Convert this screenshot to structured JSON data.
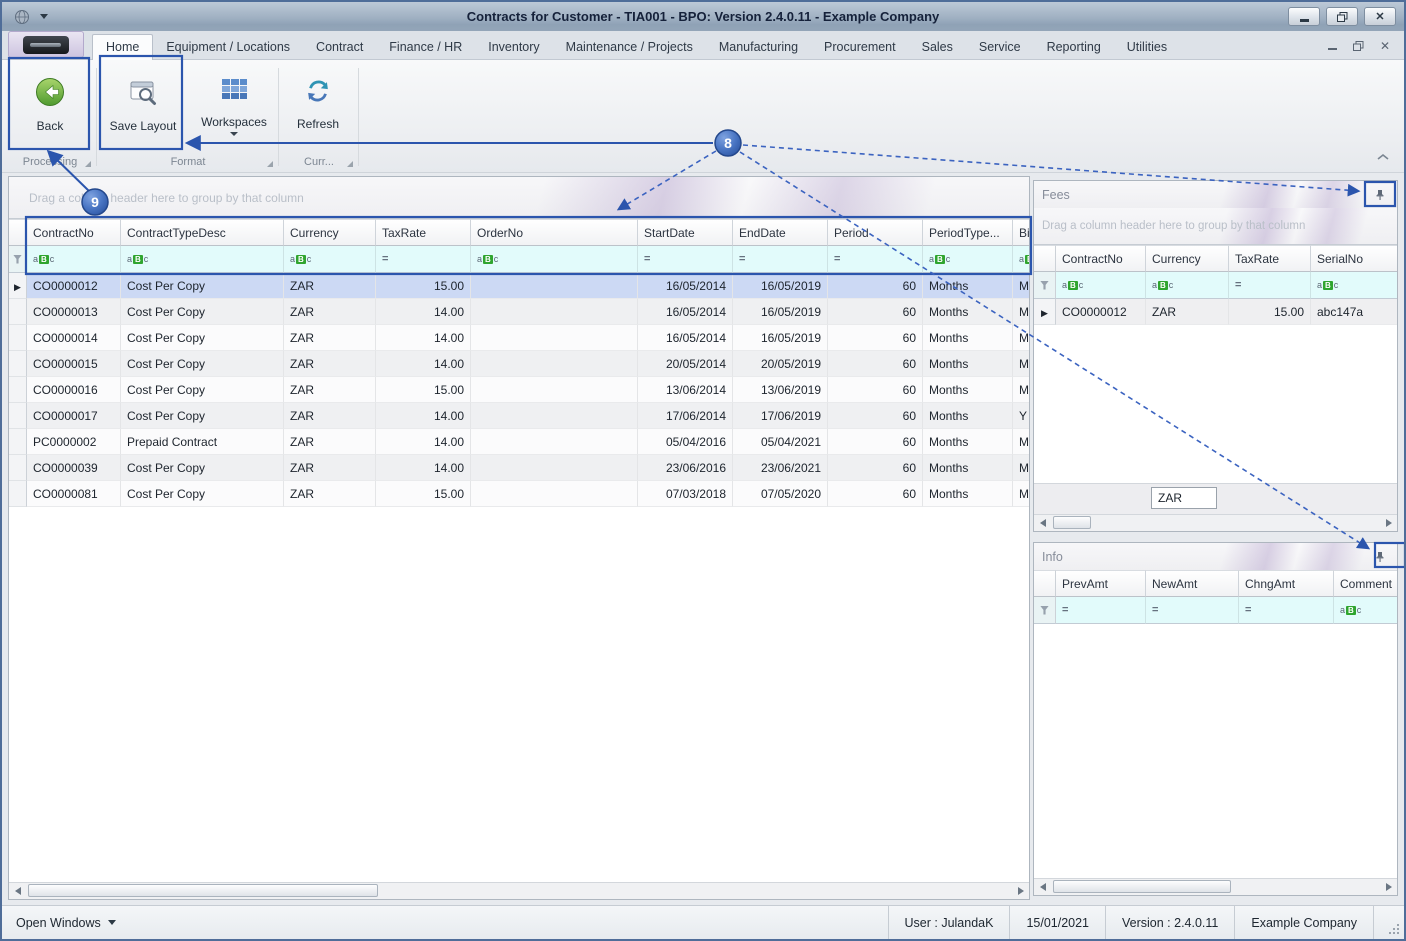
{
  "window": {
    "title": "Contracts for Customer - TIA001 - BPO: Version 2.4.0.11 - Example Company"
  },
  "ribbon": {
    "tabs": [
      {
        "label": "Home",
        "active": true
      },
      {
        "label": "Equipment / Locations"
      },
      {
        "label": "Contract"
      },
      {
        "label": "Finance / HR"
      },
      {
        "label": "Inventory"
      },
      {
        "label": "Maintenance / Projects"
      },
      {
        "label": "Manufacturing"
      },
      {
        "label": "Procurement"
      },
      {
        "label": "Sales"
      },
      {
        "label": "Service"
      },
      {
        "label": "Reporting"
      },
      {
        "label": "Utilities"
      }
    ],
    "buttons": {
      "back": "Back",
      "save_layout": "Save Layout",
      "workspaces": "Workspaces",
      "refresh": "Refresh"
    },
    "groups": {
      "processing": "Processing",
      "format": "Format",
      "currency": "Curr..."
    }
  },
  "main_grid": {
    "group_panel_text": "Drag a column header here to group by that column",
    "columns": [
      "ContractNo",
      "ContractTypeDesc",
      "Currency",
      "TaxRate",
      "OrderNo",
      "StartDate",
      "EndDate",
      "Period",
      "PeriodType...",
      "Bil"
    ],
    "filters": [
      "abc",
      "abc",
      "abc",
      "eq",
      "abc",
      "eq",
      "eq",
      "eq",
      "abc",
      "abc"
    ],
    "rows": [
      {
        "arrow": true,
        "selected": true,
        "cells": [
          "CO0000012",
          "Cost Per Copy",
          "ZAR",
          "15.00",
          "",
          "16/05/2014",
          "16/05/2019",
          "60",
          "Months",
          "M"
        ]
      },
      {
        "cells": [
          "CO0000013",
          "Cost Per Copy",
          "ZAR",
          "14.00",
          "",
          "16/05/2014",
          "16/05/2019",
          "60",
          "Months",
          "M"
        ]
      },
      {
        "cells": [
          "CO0000014",
          "Cost Per Copy",
          "ZAR",
          "14.00",
          "",
          "16/05/2014",
          "16/05/2019",
          "60",
          "Months",
          "M"
        ]
      },
      {
        "cells": [
          "CO0000015",
          "Cost Per Copy",
          "ZAR",
          "14.00",
          "",
          "20/05/2014",
          "20/05/2019",
          "60",
          "Months",
          "M"
        ]
      },
      {
        "cells": [
          "CO0000016",
          "Cost Per Copy",
          "ZAR",
          "15.00",
          "",
          "13/06/2014",
          "13/06/2019",
          "60",
          "Months",
          "M"
        ]
      },
      {
        "cells": [
          "CO0000017",
          "Cost Per Copy",
          "ZAR",
          "14.00",
          "",
          "17/06/2014",
          "17/06/2019",
          "60",
          "Months",
          "Y"
        ]
      },
      {
        "cells": [
          "PC0000002",
          "Prepaid Contract",
          "ZAR",
          "14.00",
          "",
          "05/04/2016",
          "05/04/2021",
          "60",
          "Months",
          "M"
        ]
      },
      {
        "cells": [
          "CO0000039",
          "Cost Per Copy",
          "ZAR",
          "14.00",
          "",
          "23/06/2016",
          "23/06/2021",
          "60",
          "Months",
          "M"
        ]
      },
      {
        "cells": [
          "CO0000081",
          "Cost Per Copy",
          "ZAR",
          "15.00",
          "",
          "07/03/2018",
          "07/05/2020",
          "60",
          "Months",
          "M"
        ]
      }
    ]
  },
  "fees_panel": {
    "title": "Fees",
    "group_panel_text": "Drag a column header here to group by that column",
    "columns": [
      "ContractNo",
      "Currency",
      "TaxRate",
      "SerialNo"
    ],
    "filters": [
      "abc",
      "abc",
      "eq",
      "abc"
    ],
    "rows": [
      {
        "arrow": true,
        "cells": [
          "CO0000012",
          "ZAR",
          "15.00",
          "abc147a"
        ]
      }
    ],
    "footer_value": "ZAR"
  },
  "info_panel": {
    "title": "Info",
    "columns": [
      "PrevAmt",
      "NewAmt",
      "ChngAmt",
      "Comment"
    ],
    "filters": [
      "eq",
      "eq",
      "eq",
      "abc"
    ],
    "rows": []
  },
  "status_bar": {
    "open_windows": "Open Windows",
    "user": "User : JulandaK",
    "date": "15/01/2021",
    "version": "Version : 2.4.0.11",
    "company": "Example Company"
  },
  "annotations": {
    "step_8": "8",
    "step_9": "9",
    "accent_color": "#2b55ad"
  }
}
